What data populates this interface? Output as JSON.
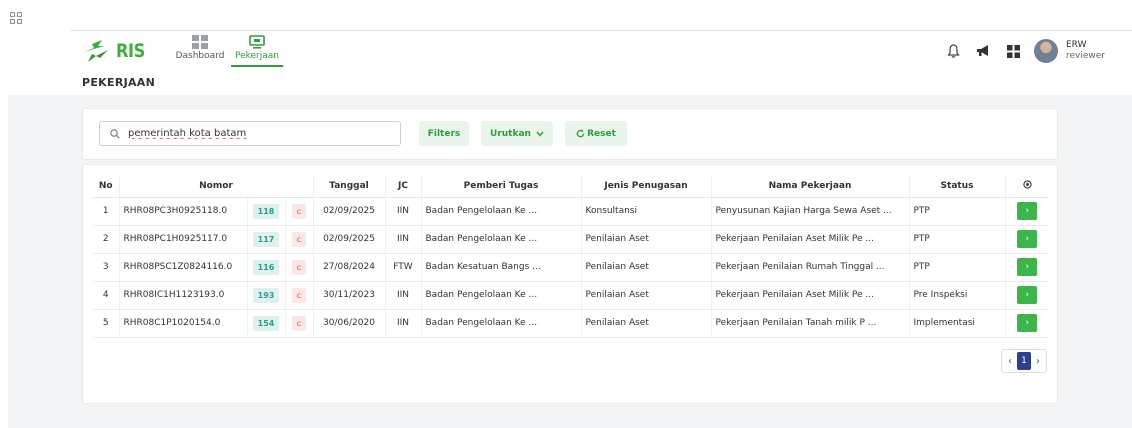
{
  "app": {
    "logo_text": "RIS"
  },
  "nav": {
    "items": [
      {
        "label": "Dashboard"
      },
      {
        "label": "Pekerjaan"
      }
    ]
  },
  "user": {
    "name": "ERW",
    "role": "reviewer"
  },
  "page": {
    "title": "PEKERJAAN"
  },
  "search": {
    "value": "pemerintah kota batam",
    "filters_label": "Filters",
    "sort_label": "Urutkan",
    "reset_label": "Reset"
  },
  "table": {
    "headers": {
      "no": "No",
      "nomor": "Nomor",
      "tanggal": "Tanggal",
      "jc": "JC",
      "pemberi": "Pemberi Tugas",
      "jenis": "Jenis Penugasan",
      "nama": "Nama Pekerjaan",
      "status": "Status"
    },
    "rows": [
      {
        "no": "1",
        "nomor": "RHR08PC3H0925118.0",
        "id": "118",
        "c": "c",
        "tanggal": "02/09/2025",
        "jc": "IIN",
        "pemberi": "Badan Pengelolaan Ke ...",
        "jenis": "Konsultansi",
        "nama": "Penyusunan Kajian Harga Sewa Aset ...",
        "status": "PTP"
      },
      {
        "no": "2",
        "nomor": "RHR08PC1H0925117.0",
        "id": "117",
        "c": "c",
        "tanggal": "02/09/2025",
        "jc": "IIN",
        "pemberi": "Badan Pengelolaan Ke ...",
        "jenis": "Penilaian Aset",
        "nama": "Pekerjaan Penilaian Aset Milik Pe ...",
        "status": "PTP"
      },
      {
        "no": "3",
        "nomor": "RHR08PSC1Z0824116.0",
        "id": "116",
        "c": "c",
        "tanggal": "27/08/2024",
        "jc": "FTW",
        "pemberi": "Badan Kesatuan Bangs ...",
        "jenis": "Penilaian Aset",
        "nama": "Pekerjaan Penilaian Rumah Tinggal ...",
        "status": "PTP"
      },
      {
        "no": "4",
        "nomor": "RHR08IC1H1123193.0",
        "id": "193",
        "c": "c",
        "tanggal": "30/11/2023",
        "jc": "IIN",
        "pemberi": "Badan Pengelolaan Ke ...",
        "jenis": "Penilaian Aset",
        "nama": "Pekerjaan Penilaian Aset Milik Pe ...",
        "status": "Pre Inspeksi"
      },
      {
        "no": "5",
        "nomor": "RHR08C1P1020154.0",
        "id": "154",
        "c": "c",
        "tanggal": "30/06/2020",
        "jc": "IIN",
        "pemberi": "Badan Pengelolaan Ke ...",
        "jenis": "Penilaian Aset",
        "nama": "Pekerjaan Penilaian Tanah milik P ...",
        "status": "Implementasi"
      }
    ]
  },
  "pagination": {
    "prev": "‹",
    "current": "1",
    "next": "›"
  }
}
